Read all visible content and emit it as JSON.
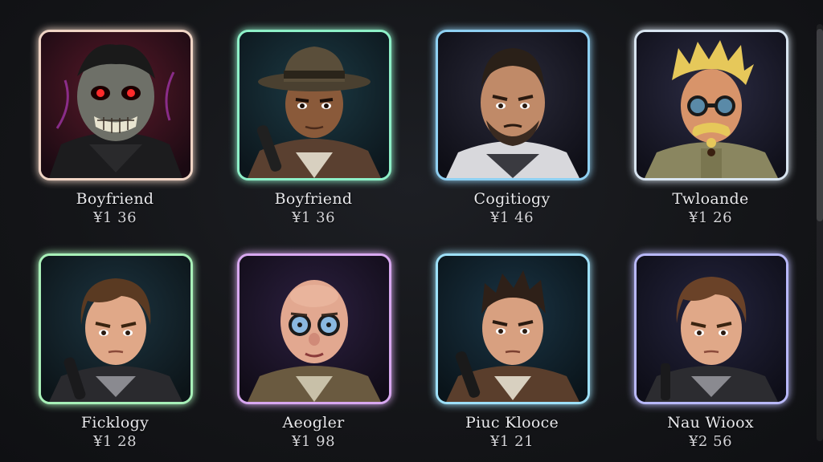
{
  "colors": {
    "background": "#141518",
    "frame_peach": "#f0d4c4",
    "frame_mint": "#8ef0c8",
    "frame_sky": "#8fd0f2",
    "frame_silver": "#d8e4f0",
    "frame_green": "#a8f0b8",
    "frame_lilac": "#d8a8f0",
    "frame_cyan": "#9ee0f8",
    "frame_periwinkle": "#b8b8f8"
  },
  "characters": [
    {
      "name": "Boyfriend",
      "price": "¥1 36",
      "icon": "zombie-portrait"
    },
    {
      "name": "Boyfriend",
      "price": "¥1 36",
      "icon": "fedora-man-portrait"
    },
    {
      "name": "Cogitiogy",
      "price": "¥1 46",
      "icon": "bearded-man-portrait"
    },
    {
      "name": "Twloande",
      "price": "¥1 26",
      "icon": "goggles-blond-man-portrait"
    },
    {
      "name": "Ficklogy",
      "price": "¥1 28",
      "icon": "brown-hair-boy-portrait"
    },
    {
      "name": "Aeogler",
      "price": "¥1 98",
      "icon": "bald-glasses-man-portrait"
    },
    {
      "name": "Piuc Klooce",
      "price": "¥1 21",
      "icon": "spiky-hair-man-portrait"
    },
    {
      "name": "Nau Wioox",
      "price": "¥2 56",
      "icon": "brown-hair-man-portrait"
    }
  ]
}
